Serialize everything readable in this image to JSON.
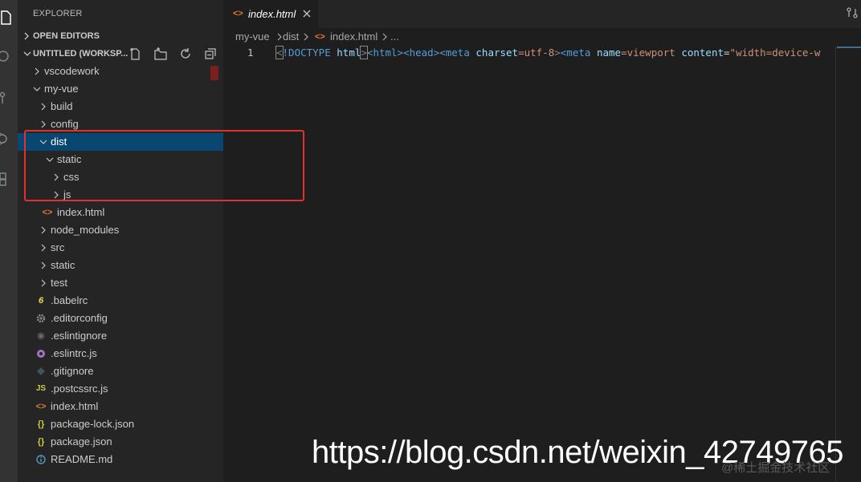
{
  "explorer": {
    "title": "EXPLORER",
    "open_editors": "OPEN EDITORS",
    "workspace": "UNTITLED (WORKSP..."
  },
  "tree": [
    {
      "label": "vscodework",
      "type": "folder",
      "expanded": false,
      "depth": 0
    },
    {
      "label": "my-vue",
      "type": "folder",
      "expanded": true,
      "depth": 0
    },
    {
      "label": "build",
      "type": "folder",
      "expanded": false,
      "depth": 1
    },
    {
      "label": "config",
      "type": "folder",
      "expanded": false,
      "depth": 1
    },
    {
      "label": "dist",
      "type": "folder",
      "expanded": true,
      "depth": 1,
      "selected": true
    },
    {
      "label": "static",
      "type": "folder",
      "expanded": true,
      "depth": 2
    },
    {
      "label": "css",
      "type": "folder",
      "expanded": false,
      "depth": 3
    },
    {
      "label": "js",
      "type": "folder",
      "expanded": false,
      "depth": 3
    },
    {
      "label": "index.html",
      "type": "html",
      "depth": 2
    },
    {
      "label": "node_modules",
      "type": "folder",
      "expanded": false,
      "depth": 1
    },
    {
      "label": "src",
      "type": "folder",
      "expanded": false,
      "depth": 1
    },
    {
      "label": "static",
      "type": "folder",
      "expanded": false,
      "depth": 1
    },
    {
      "label": "test",
      "type": "folder",
      "expanded": false,
      "depth": 1
    },
    {
      "label": ".babelrc",
      "type": "babel",
      "depth": 1
    },
    {
      "label": ".editorconfig",
      "type": "gear",
      "depth": 1
    },
    {
      "label": ".eslintignore",
      "type": "eslint-ignore",
      "depth": 1
    },
    {
      "label": ".eslintrc.js",
      "type": "eslint",
      "depth": 1
    },
    {
      "label": ".gitignore",
      "type": "git",
      "depth": 1
    },
    {
      "label": ".postcssrc.js",
      "type": "js",
      "depth": 1
    },
    {
      "label": "index.html",
      "type": "html",
      "depth": 1
    },
    {
      "label": "package-lock.json",
      "type": "json",
      "depth": 1
    },
    {
      "label": "package.json",
      "type": "json",
      "depth": 1
    },
    {
      "label": "README.md",
      "type": "info",
      "depth": 1
    }
  ],
  "icon_glyphs": {
    "html": "<>",
    "babel": "6",
    "js": "JS",
    "json": "{}"
  },
  "tab": {
    "label": "index.html"
  },
  "breadcrumb": {
    "p1": "my-vue",
    "p2": "dist",
    "p3": "index.html",
    "p4": "..."
  },
  "editor": {
    "line_number": "1",
    "code": {
      "t1": "<",
      "t2": "!DOCTYPE",
      "t3": "html",
      "t4": ">",
      "t5": "<html>",
      "t6": "<head>",
      "t7": "<meta",
      "t8": "charset",
      "t9": "=utf-8",
      "t10": ">",
      "t11": "<meta",
      "t12": "name",
      "t13": "=viewport",
      "t14": "content",
      "t15": "=",
      "t16": "\"width=device-w"
    }
  },
  "watermark": {
    "url": "https://blog.csdn.net/weixin_42749765",
    "site": "@稀土掘金技术社区"
  },
  "colors": {
    "accent": "#094771",
    "highlight": "#e03030",
    "html_icon": "#e37933",
    "folder_text": "#cccccc"
  }
}
